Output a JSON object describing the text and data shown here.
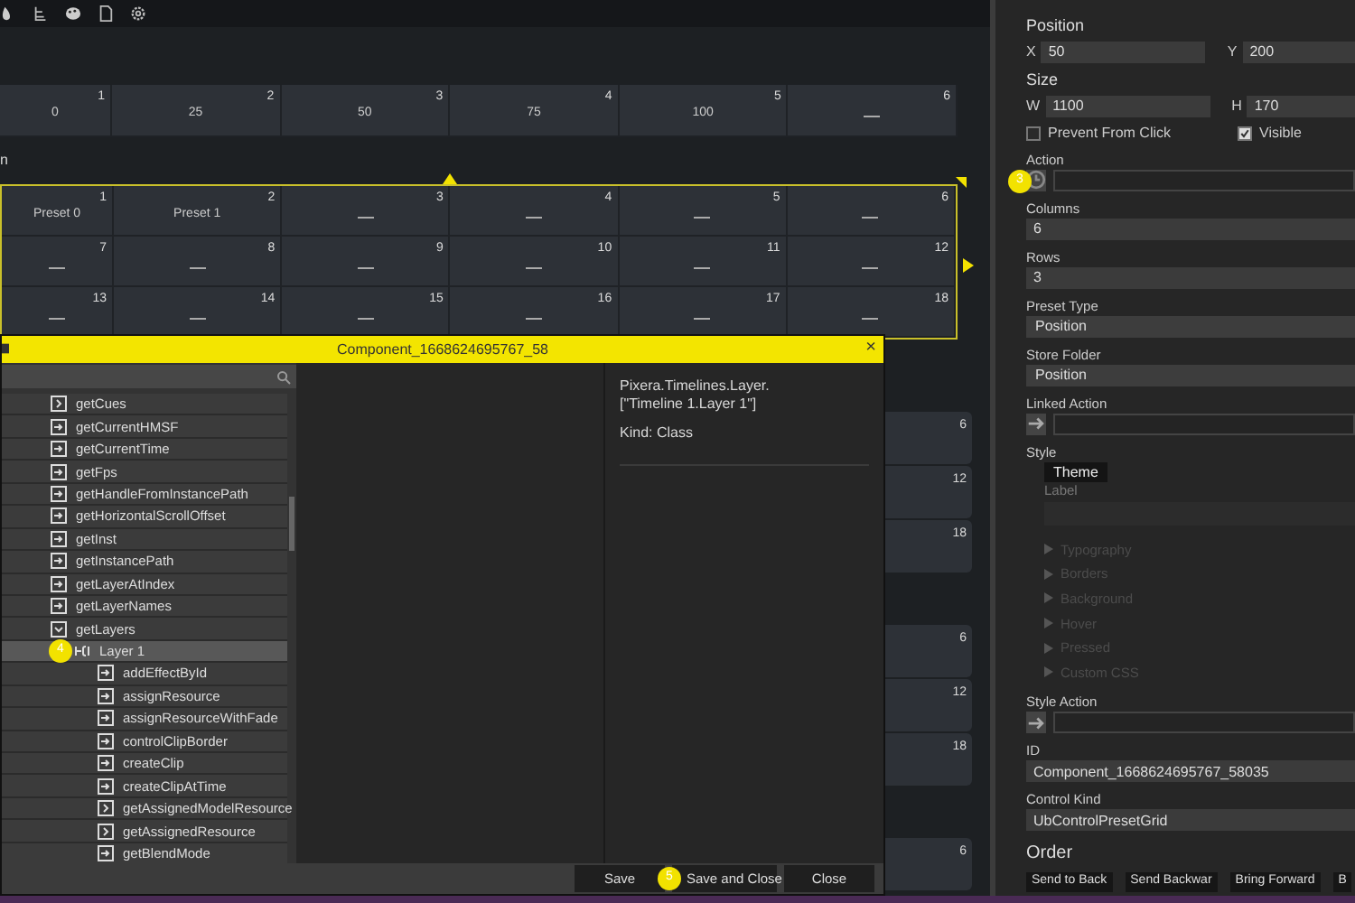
{
  "top_grid": {
    "cells": [
      {
        "number": "1",
        "label": "0"
      },
      {
        "number": "2",
        "label": "25"
      },
      {
        "number": "3",
        "label": "50"
      },
      {
        "number": "4",
        "label": "75"
      },
      {
        "number": "5",
        "label": "100"
      },
      {
        "number": "6"
      }
    ]
  },
  "section_label": "n",
  "preset_grid": {
    "selected": true,
    "cells": [
      {
        "number": "1",
        "label": "Preset 0"
      },
      {
        "number": "2",
        "label": "Preset 1"
      },
      {
        "number": "3"
      },
      {
        "number": "4"
      },
      {
        "number": "5"
      },
      {
        "number": "6"
      },
      {
        "number": "7"
      },
      {
        "number": "8"
      },
      {
        "number": "9"
      },
      {
        "number": "10"
      },
      {
        "number": "11"
      },
      {
        "number": "12"
      },
      {
        "number": "13"
      },
      {
        "number": "14"
      },
      {
        "number": "15"
      },
      {
        "number": "16"
      },
      {
        "number": "17"
      },
      {
        "number": "18"
      }
    ]
  },
  "background_cell_groups": [
    [
      "6",
      "12",
      "18"
    ],
    [
      "6",
      "12",
      "18"
    ],
    [
      "6"
    ]
  ],
  "dialog": {
    "title": "Component_1668624695767_58",
    "close": "×",
    "tree": [
      {
        "label": "getCues",
        "kind": "property",
        "selected": false
      },
      {
        "label": "getCurrentHMSF",
        "kind": "method",
        "selected": false
      },
      {
        "label": "getCurrentTime",
        "kind": "method",
        "selected": false
      },
      {
        "label": "getFps",
        "kind": "method",
        "selected": false
      },
      {
        "label": "getHandleFromInstancePath",
        "kind": "method",
        "selected": false
      },
      {
        "label": "getHorizontalScrollOffset",
        "kind": "method",
        "selected": false
      },
      {
        "label": "getInst",
        "kind": "method",
        "selected": false
      },
      {
        "label": "getInstancePath",
        "kind": "method",
        "selected": false
      },
      {
        "label": "getLayerAtIndex",
        "kind": "method",
        "selected": false
      },
      {
        "label": "getLayerNames",
        "kind": "method",
        "selected": false
      },
      {
        "label": "getLayers",
        "kind": "group",
        "selected": false,
        "expanded": true,
        "children": [
          {
            "label": "Layer 1",
            "kind": "class",
            "selected": true,
            "expanded": true,
            "marker": "4",
            "children": [
              {
                "label": "addEffectById",
                "kind": "method",
                "selected": false
              },
              {
                "label": "assignResource",
                "kind": "method",
                "selected": false
              },
              {
                "label": "assignResourceWithFade",
                "kind": "method",
                "selected": false
              },
              {
                "label": "controlClipBorder",
                "kind": "method",
                "selected": false
              },
              {
                "label": "createClip",
                "kind": "method",
                "selected": false
              },
              {
                "label": "createClipAtTime",
                "kind": "method",
                "selected": false
              },
              {
                "label": "getAssignedModelResource",
                "kind": "property",
                "selected": false
              },
              {
                "label": "getAssignedResource",
                "kind": "property",
                "selected": false
              },
              {
                "label": "getBlendMode",
                "kind": "method",
                "selected": false
              }
            ]
          }
        ]
      }
    ],
    "info": {
      "path_lines": [
        "Pixera.Timelines.Layer.",
        "[\"Timeline 1.Layer 1\"]"
      ],
      "kind_line": "Kind: Class"
    },
    "buttons": [
      {
        "label": "Save"
      },
      {
        "label": "Save and Close",
        "marker": "5"
      },
      {
        "label": "Close"
      }
    ]
  },
  "panel": [
    {
      "kind": "heading",
      "text": "Position"
    },
    {
      "kind": "pair",
      "a_label": "X",
      "a_value": "50",
      "b_label": "Y",
      "b_value": "200"
    },
    {
      "kind": "heading",
      "text": "Size"
    },
    {
      "kind": "pair",
      "a_label": "W",
      "a_value": "1100",
      "b_label": "H",
      "b_value": "170"
    },
    {
      "kind": "checks",
      "items": [
        {
          "label": "Prevent From Click",
          "checked": false
        },
        {
          "label": "Visible",
          "checked": true
        }
      ]
    },
    {
      "kind": "action",
      "label": "Action",
      "marker": "3"
    },
    {
      "kind": "field",
      "label": "Columns",
      "value": "6"
    },
    {
      "kind": "field",
      "label": "Rows",
      "value": "3"
    },
    {
      "kind": "select",
      "label": "Preset Type",
      "value": "Position"
    },
    {
      "kind": "select",
      "label": "Store Folder",
      "value": "Position"
    },
    {
      "kind": "link",
      "label": "Linked Action"
    },
    {
      "kind": "style",
      "label": "Style",
      "tab": "Theme",
      "sub_label": "Label",
      "sections": [
        {
          "label": "Typography",
          "disabled": true
        },
        {
          "label": "Borders",
          "disabled": true
        },
        {
          "label": "Background",
          "disabled": true
        },
        {
          "label": "Hover",
          "disabled": true
        },
        {
          "label": "Pressed",
          "disabled": true
        },
        {
          "label": "Custom CSS",
          "disabled": true
        }
      ]
    },
    {
      "kind": "link",
      "label": "Style Action"
    },
    {
      "kind": "field",
      "label": "ID",
      "value": "Component_1668624695767_58035"
    },
    {
      "kind": "field",
      "label": "Control Kind",
      "value": "UbControlPresetGrid"
    },
    {
      "kind": "order",
      "text": "Order",
      "buttons": [
        "Send to Back",
        "Send Backwar",
        "Bring Forward",
        "B"
      ]
    }
  ]
}
